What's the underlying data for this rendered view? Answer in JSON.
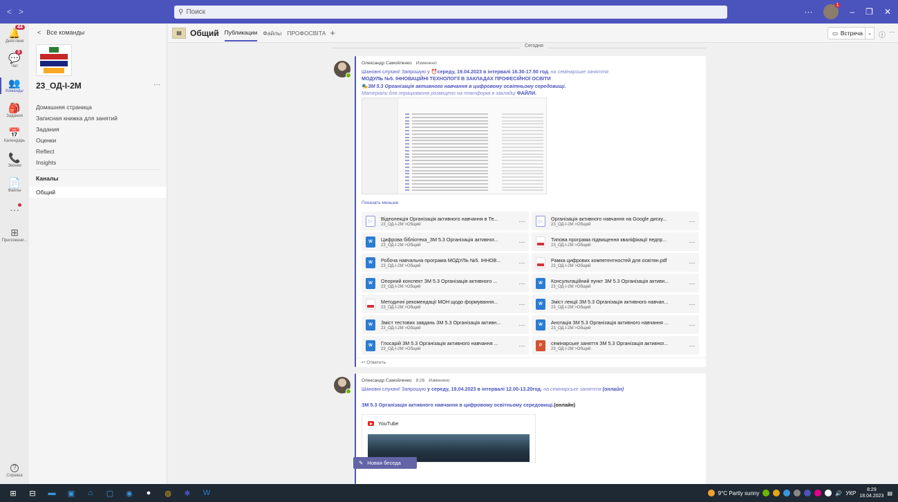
{
  "search": {
    "placeholder": "Поиск"
  },
  "titlebar": {
    "avatar_badge": "1",
    "minimize": "–",
    "restore": "❐",
    "close": "✕",
    "more": "···"
  },
  "rail": [
    {
      "name": "activity",
      "label": "Действия",
      "icon": "🔔",
      "badge": "44"
    },
    {
      "name": "chat",
      "label": "Чат",
      "icon": "💬",
      "badge": "3"
    },
    {
      "name": "teams",
      "label": "Команды",
      "icon": "👥",
      "badge": "",
      "active": true
    },
    {
      "name": "assignments",
      "label": "Задания",
      "icon": "🎒",
      "badge": ""
    },
    {
      "name": "calendar",
      "label": "Календарь",
      "icon": "📅",
      "badge": ""
    },
    {
      "name": "calls",
      "label": "Звонки",
      "icon": "📞",
      "badge": ""
    },
    {
      "name": "files",
      "label": "Файлы",
      "icon": "📄",
      "badge": ""
    },
    {
      "name": "more",
      "label": "",
      "icon": "···",
      "badge": "",
      "dot": true
    },
    {
      "name": "apps",
      "label": "Приложени...",
      "icon": "⊞",
      "badge": ""
    }
  ],
  "help": {
    "label": "Справка",
    "icon": "?"
  },
  "panel": {
    "back": "Все команды",
    "team_name": "23_ОД-І-2М",
    "links": [
      "Домашняя страница",
      "Записная книжка для занятий",
      "Задания",
      "Оценки",
      "Reflect",
      "Insights"
    ],
    "channels_header": "Каналы",
    "channel": "Общий"
  },
  "header": {
    "title": "Общий",
    "tabs": [
      "Публикации",
      "Файлы",
      "ПРОФОСВІТА"
    ],
    "meet": "Встреча"
  },
  "feed": {
    "date": "Сегодня",
    "post1": {
      "author": "Олександр Самойленко",
      "edited": "Изменено",
      "line1_a": "Шановні слухачі! Запрошую у ",
      "line1_b": "середу, 19.04.2023 в інтервалі 16.30-17.50 год.",
      "line1_c": " на семінарське заняття",
      "line2": "МОДУЛЬ №5. ІННОВАЦІЙНІ ТЕХНОЛОГІЇ В ЗАКЛАДАХ ПРОФЕСІЙНОЇ ОСВІТИ",
      "line3": "ЗМ 5.3 Організація активного навчання в цифровому освітньому середовищі.",
      "line4_a": "Матеріали для опрацювання розміщено на платформі в закладці ",
      "line4_b": "ФАЙЛИ.",
      "show_less": "Показать меньше",
      "reply": "Ответить",
      "files": [
        {
          "name": "Відеолекція Організація активного навчання в Те...",
          "path": "23_ОД-І-2М >Общий",
          "type": "video"
        },
        {
          "name": "Організація активного навчання на Google диску...",
          "path": "23_ОД-І-2М >Общий",
          "type": "video"
        },
        {
          "name": "Цифрова бібліотека_ЗМ 5.3 Організація активног...",
          "path": "23_ОД-І-2М >Общий",
          "type": "word"
        },
        {
          "name": "Типова програма підвищення кваліфікації педпр...",
          "path": "23_ОД-І-2М >Общий",
          "type": "pdf"
        },
        {
          "name": "Робоча навчальна програма МОДУЛЬ №5. ІННОВ...",
          "path": "23_ОД-І-2М >Общий",
          "type": "word"
        },
        {
          "name": "Рамка цифрових компетентностей для освітян.pdf",
          "path": "23_ОД-І-2М >Общий",
          "type": "pdf"
        },
        {
          "name": "Опорний конспект ЗМ 5.3 Організація активного ...",
          "path": "23_ОД-І-2М >Общий",
          "type": "word"
        },
        {
          "name": "Консультаційний пункт ЗМ 5.3 Організація активн...",
          "path": "23_ОД-І-2М >Общий",
          "type": "word"
        },
        {
          "name": "Методичні рекомендації МОН щодо формування...",
          "path": "23_ОД-І-2М >Общий",
          "type": "pdf"
        },
        {
          "name": "Зміст лекції ЗМ 5.3 Організація активного навчан...",
          "path": "23_ОД-І-2М >Общий",
          "type": "word"
        },
        {
          "name": "Зміст тестових завдань ЗМ 5.3 Організація активн...",
          "path": "23_ОД-І-2М >Общий",
          "type": "word"
        },
        {
          "name": "Анотація ЗМ 5.3 Організація активного навчання ...",
          "path": "23_ОД-І-2М >Общий",
          "type": "word"
        },
        {
          "name": "Глосарій ЗМ 5.3 Організація активного навчання ...",
          "path": "23_ОД-І-2М >Общий",
          "type": "word"
        },
        {
          "name": "семінарське заняття ЗМ 5.3 Організація активног...",
          "path": "23_ОД-І-2М >Общий",
          "type": "ppt"
        }
      ]
    },
    "post2": {
      "author": "Олександр Самойленко",
      "time": "8:26",
      "edited": "Изменено",
      "line1_a": "Шановні слухачі! Запрошую ",
      "line1_b": "у середу, 19.04.2023 в інтервалі 12.00-13.20год.",
      "line1_c": " на семінарське заняття ",
      "line1_d": "(онлайн)",
      "line2_a": "ЗМ 5.3 Організація активного навчання в цифровому освітньому середовищі.",
      "line2_b": "(онлайн)",
      "youtube": "YouTube"
    },
    "new_conversation": "Новая беседа"
  },
  "taskbar": {
    "apps": [
      "⊞",
      "⊟",
      "▬",
      "▣",
      "⌂",
      "▢",
      "◉",
      "●",
      "◍",
      "✱",
      "W"
    ],
    "weather": "9°C  Partly sunny",
    "lang": "УКР",
    "time": "8:29",
    "date": "18.04.2023"
  },
  "colors": {
    "accent": "#4b53bc",
    "titlebar": "#4b53bc",
    "badge": "#c4314b",
    "online": "#6bb700"
  }
}
